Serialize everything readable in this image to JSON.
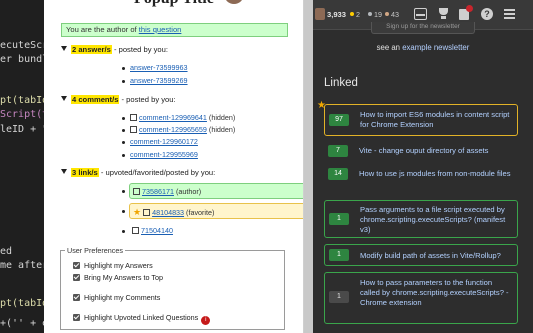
{
  "code_editor": {
    "lines": [
      {
        "text": "ecuteScript.",
        "color": "white"
      },
      {
        "text": "er bundlin",
        "color": "white"
      },
      {
        "text": "pt(tabId,",
        "color": "yellow"
      },
      {
        "text": "Script(tab",
        "color": "pink"
      },
      {
        "text": "leID + \"'",
        "color": "white"
      },
      {
        "text": "ed",
        "color": "white"
      },
      {
        "text": "me after b",
        "color": "white"
      },
      {
        "text": "pt(tabId,",
        "color": "yellow"
      },
      {
        "text": "+('' + el",
        "color": "white"
      }
    ]
  },
  "popup": {
    "title": "Popup Title",
    "author_notice": {
      "prefix": "You are the author of ",
      "link": "this question"
    },
    "answers": {
      "count": "2 answer/s",
      "suffix": " - posted by you:",
      "items": [
        "answer-73599963",
        "answer-73599269"
      ]
    },
    "comments": {
      "count": "4 comment/s",
      "suffix": " - posted by you:",
      "items": [
        {
          "label": "comment-129969641",
          "note": " (hidden)",
          "ext": true
        },
        {
          "label": "comment-129965659",
          "note": " (hidden)",
          "ext": true
        },
        {
          "label": "comment-129960172",
          "note": "",
          "ext": false
        },
        {
          "label": "comment-129955969",
          "note": "",
          "ext": false
        }
      ]
    },
    "links": {
      "count": "3 link/s",
      "suffix": " - upvoted/favorited/posted by you:",
      "items": [
        {
          "label": "73586171",
          "note": " (author)",
          "style": "author"
        },
        {
          "label": "48104833",
          "note": " (favorite)",
          "style": "favorite"
        },
        {
          "label": "71504140",
          "note": "",
          "style": "plain"
        }
      ]
    },
    "preferences": {
      "legend": "User Preferences",
      "options": [
        {
          "label": "Highlight my Answers",
          "checked": true,
          "info": false
        },
        {
          "label": "Bring My Answers to Top",
          "checked": true,
          "info": false
        },
        {
          "label": "Highlight my Comments",
          "checked": true,
          "info": false
        },
        {
          "label": "Highlight Upvoted Linked Questions",
          "checked": true,
          "info": true
        }
      ]
    },
    "colors": {
      "author_bg": "#ccffcc",
      "favorite_bg": "#fff5cc",
      "highlight": "#ffe600"
    }
  },
  "stackoverflow": {
    "reputation": "3,933",
    "badges": {
      "gold": "2",
      "silver": "19",
      "bronze": "43"
    },
    "topbar_icons": [
      "inbox-icon",
      "trophy-icon",
      "review-icon",
      "help-icon",
      "menu-icon"
    ],
    "newsletter_button": "Sign up for the newsletter",
    "newsletter_text": {
      "prefix": "see an ",
      "link": "example newsletter"
    },
    "linked_title": "Linked",
    "linked": [
      {
        "score": "97",
        "title": "How to import ES6 modules in content script for Chrome Extension",
        "style": "favorite",
        "score_style": "green"
      },
      {
        "score": "7",
        "title": "Vite - change ouput directory of assets",
        "style": "none",
        "score_style": "green"
      },
      {
        "score": "14",
        "title": "How to use js modules from non-module files",
        "style": "none",
        "score_style": "green"
      },
      {
        "score": "1",
        "title": "Pass arguments to a file script executed by chrome.scripting.executeScripts? (manifest v3)",
        "style": "author",
        "score_style": "green"
      },
      {
        "score": "1",
        "title": "Modify build path of assets in Vite/Rollup?",
        "style": "author",
        "score_style": "green"
      },
      {
        "score": "1",
        "title": "How to pass parameters to the function called by chrome.scripting.executeScripts? - Chrome extension",
        "style": "author",
        "score_style": "gray"
      }
    ],
    "colors": {
      "accepted_green": "#2e8540",
      "author_border": "#3aa54b",
      "favorite_border": "#e2b227",
      "link": "#b3d1ff"
    }
  }
}
